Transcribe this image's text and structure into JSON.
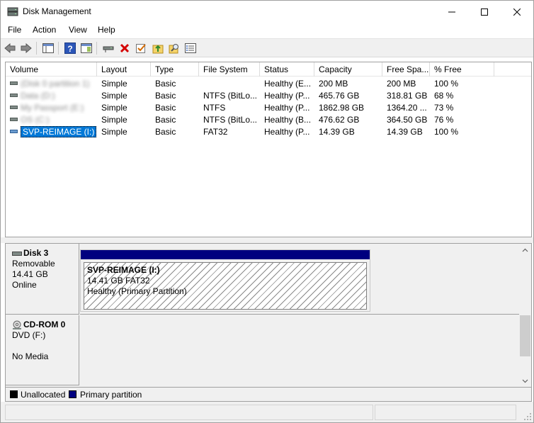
{
  "window": {
    "title": "Disk Management"
  },
  "menu": [
    "File",
    "Action",
    "View",
    "Help"
  ],
  "toolbar": {
    "buttons": [
      "back-icon",
      "forward-icon",
      "console-tree-icon",
      "help-icon",
      "properties-pane-icon",
      "connect-icon",
      "delete-icon",
      "check-icon",
      "up-folder-icon",
      "search-folder-icon",
      "list-view-icon"
    ]
  },
  "volume_list": {
    "columns": [
      "Volume",
      "Layout",
      "Type",
      "File System",
      "Status",
      "Capacity",
      "Free Spa...",
      "% Free"
    ],
    "rows": [
      {
        "volume": "(Disk 0 partition 1)",
        "layout": "Simple",
        "type": "Basic",
        "fs": "",
        "status": "Healthy (E...",
        "capacity": "200 MB",
        "free": "200 MB",
        "pct": "100 %",
        "blurred": true,
        "icon": "drive-icon"
      },
      {
        "volume": "Data (D:)",
        "layout": "Simple",
        "type": "Basic",
        "fs": "NTFS (BitLo...",
        "status": "Healthy (P...",
        "capacity": "465.76 GB",
        "free": "318.81 GB",
        "pct": "68 %",
        "blurred": true,
        "icon": "drive-icon"
      },
      {
        "volume": "My Passport (E:)",
        "layout": "Simple",
        "type": "Basic",
        "fs": "NTFS",
        "status": "Healthy (P...",
        "capacity": "1862.98 GB",
        "free": "1364.20 ...",
        "pct": "73 %",
        "blurred": true,
        "icon": "drive-icon"
      },
      {
        "volume": "OS (C:)",
        "layout": "Simple",
        "type": "Basic",
        "fs": "NTFS (BitLo...",
        "status": "Healthy (B...",
        "capacity": "476.62 GB",
        "free": "364.50 GB",
        "pct": "76 %",
        "blurred": true,
        "icon": "drive-icon"
      },
      {
        "volume": "SVP-REIMAGE (I:)",
        "layout": "Simple",
        "type": "Basic",
        "fs": "FAT32",
        "status": "Healthy (P...",
        "capacity": "14.39 GB",
        "free": "14.39 GB",
        "pct": "100 %",
        "blurred": false,
        "selected": true,
        "icon": "usb-drive-icon"
      }
    ]
  },
  "disks": [
    {
      "name": "Disk 3",
      "kind": "Removable",
      "size": "14.41 GB",
      "state": "Online",
      "partition": {
        "name": "SVP-REIMAGE  (I:)",
        "size_fs": "14.41 GB FAT32",
        "status": "Healthy (Primary Partition)"
      }
    },
    {
      "name": "CD-ROM 0",
      "kind": "DVD (F:)",
      "media": "No Media"
    }
  ],
  "legend": [
    {
      "label": "Unallocated",
      "color": "#000000"
    },
    {
      "label": "Primary partition",
      "color": "#00007f"
    }
  ],
  "colors": {
    "selection": "#0078d7",
    "primary_partition": "#00007f",
    "delete_red": "#d40000"
  }
}
